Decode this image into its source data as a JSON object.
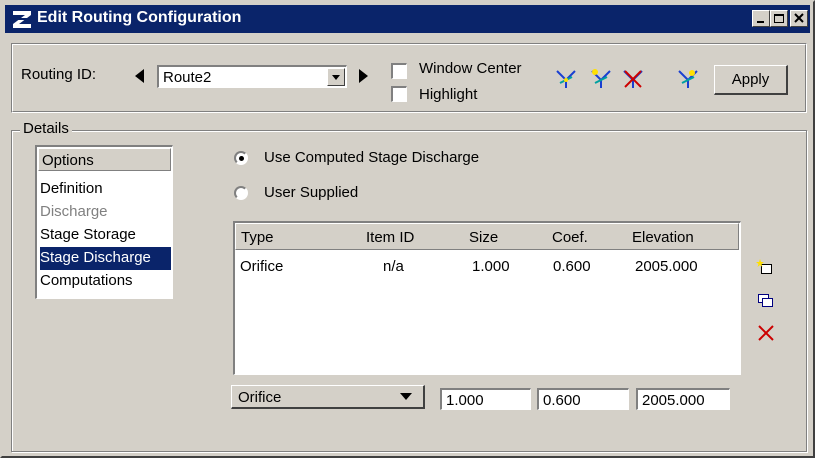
{
  "window": {
    "title": "Edit Routing Configuration",
    "controls": [
      "minimize-icon",
      "maximize-icon",
      "close-icon"
    ]
  },
  "toolbar": {
    "routing_id_label": "Routing ID:",
    "routing_id_value": "Route2",
    "window_center_label": "Window Center",
    "window_center_checked": false,
    "highlight_label": "Highlight",
    "highlight_checked": false,
    "tool_icons": [
      "route-select-icon",
      "route-add-icon",
      "route-delete-icon",
      "route-edit-icon"
    ],
    "apply_label": "Apply"
  },
  "details": {
    "group_label": "Details",
    "options_header": "Options",
    "options": [
      {
        "label": "Definition",
        "state": "normal"
      },
      {
        "label": "Discharge",
        "state": "disabled"
      },
      {
        "label": "Stage Storage",
        "state": "normal"
      },
      {
        "label": "Stage Discharge",
        "state": "selected"
      },
      {
        "label": "Computations",
        "state": "normal"
      }
    ],
    "radio_computed_label": "Use Computed Stage Discharge",
    "radio_computed_selected": true,
    "radio_user_label": "User Supplied",
    "radio_user_selected": false,
    "table": {
      "columns": [
        "Type",
        "Item ID",
        "Size",
        "Coef.",
        "Elevation"
      ],
      "rows": [
        [
          "Orifice",
          "n/a",
          "1.000",
          "0.600",
          "2005.000"
        ]
      ]
    },
    "side_icons": [
      "new-item-icon",
      "copy-item-icon",
      "delete-item-icon"
    ],
    "type_select_value": "Orifice",
    "size_value": "1.000",
    "coef_value": "0.600",
    "elevation_value": "2005.000"
  },
  "colors": {
    "titlebar": "#0a246a",
    "selection": "#0a246a",
    "face": "#d4d0c8",
    "delete": "#cc0000"
  }
}
